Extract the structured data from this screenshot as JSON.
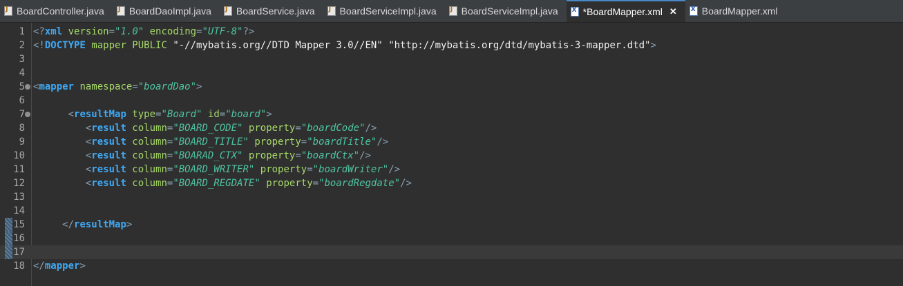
{
  "tabs": [
    {
      "label": "BoardController.java",
      "icon": "java-file-icon",
      "active": false
    },
    {
      "label": "BoardDaoImpl.java",
      "icon": "java-file-icon",
      "active": false
    },
    {
      "label": "BoardService.java",
      "icon": "java-file-icon",
      "active": false
    },
    {
      "label": "BoardServiceImpl.java",
      "icon": "java-file-icon",
      "active": false
    },
    {
      "label": "BoardServiceImpl.java",
      "icon": "java-file-icon",
      "active": false
    },
    {
      "label": "*BoardMapper.xml",
      "icon": "xml-file-icon",
      "active": true,
      "close": "✕"
    },
    {
      "label": "BoardMapper.xml",
      "icon": "xml-file-icon",
      "active": false
    }
  ],
  "editor": {
    "current_line": 17,
    "lines": [
      {
        "n": "1",
        "tokens": [
          [
            "br",
            "<?"
          ],
          [
            "kw",
            "xml"
          ],
          [
            "attr",
            " version"
          ],
          [
            "br",
            "="
          ],
          [
            "val",
            "\"1.0\""
          ],
          [
            "attr",
            " encoding"
          ],
          [
            "br",
            "="
          ],
          [
            "val",
            "\"UTF-8\""
          ],
          [
            "br",
            "?>"
          ]
        ]
      },
      {
        "n": "2",
        "tokens": [
          [
            "br",
            "<!"
          ],
          [
            "kw",
            "DOCTYPE"
          ],
          [
            "doc",
            " mapper PUBLIC "
          ],
          [
            "str",
            "\"-//mybatis.org//DTD Mapper 3.0//EN\""
          ],
          [
            "doc",
            " "
          ],
          [
            "str",
            "\"http://mybatis.org/dtd/mybatis-3-mapper.dtd\""
          ],
          [
            "br",
            ">"
          ]
        ]
      },
      {
        "n": "3",
        "tokens": []
      },
      {
        "n": "4",
        "tokens": []
      },
      {
        "n": "5",
        "fold": true,
        "tokens": [
          [
            "br",
            "<"
          ],
          [
            "tag",
            "mapper"
          ],
          [
            "attr",
            " namespace"
          ],
          [
            "br",
            "="
          ],
          [
            "val",
            "\"boardDao\""
          ],
          [
            "br",
            ">"
          ]
        ]
      },
      {
        "n": "6",
        "tokens": []
      },
      {
        "n": "7",
        "fold": true,
        "tokens": [
          [
            "str",
            "      "
          ],
          [
            "br",
            "<"
          ],
          [
            "tag",
            "resultMap"
          ],
          [
            "attr",
            " type"
          ],
          [
            "br",
            "="
          ],
          [
            "val",
            "\"Board\""
          ],
          [
            "attr",
            " id"
          ],
          [
            "br",
            "="
          ],
          [
            "val",
            "\"board\""
          ],
          [
            "br",
            ">"
          ]
        ]
      },
      {
        "n": "8",
        "tokens": [
          [
            "str",
            "         "
          ],
          [
            "br",
            "<"
          ],
          [
            "tag",
            "result"
          ],
          [
            "attr",
            " column"
          ],
          [
            "br",
            "="
          ],
          [
            "val",
            "\"BOARD_CODE\""
          ],
          [
            "attr",
            " property"
          ],
          [
            "br",
            "="
          ],
          [
            "val",
            "\"boardCode\""
          ],
          [
            "br",
            "/>"
          ]
        ]
      },
      {
        "n": "9",
        "tokens": [
          [
            "str",
            "         "
          ],
          [
            "br",
            "<"
          ],
          [
            "tag",
            "result"
          ],
          [
            "attr",
            " column"
          ],
          [
            "br",
            "="
          ],
          [
            "val",
            "\"BOARD_TITLE\""
          ],
          [
            "attr",
            " property"
          ],
          [
            "br",
            "="
          ],
          [
            "val",
            "\"boardTitle\""
          ],
          [
            "br",
            "/>"
          ]
        ]
      },
      {
        "n": "10",
        "tokens": [
          [
            "str",
            "         "
          ],
          [
            "br",
            "<"
          ],
          [
            "tag",
            "result"
          ],
          [
            "attr",
            " column"
          ],
          [
            "br",
            "="
          ],
          [
            "val",
            "\"BOARAD_CTX\""
          ],
          [
            "attr",
            " property"
          ],
          [
            "br",
            "="
          ],
          [
            "val",
            "\"boardCtx\""
          ],
          [
            "br",
            "/>"
          ]
        ]
      },
      {
        "n": "11",
        "tokens": [
          [
            "str",
            "         "
          ],
          [
            "br",
            "<"
          ],
          [
            "tag",
            "result"
          ],
          [
            "attr",
            " column"
          ],
          [
            "br",
            "="
          ],
          [
            "val",
            "\"BOARD_WRITER\""
          ],
          [
            "attr",
            " property"
          ],
          [
            "br",
            "="
          ],
          [
            "val",
            "\"boardWriter\""
          ],
          [
            "br",
            "/>"
          ]
        ]
      },
      {
        "n": "12",
        "tokens": [
          [
            "str",
            "         "
          ],
          [
            "br",
            "<"
          ],
          [
            "tag",
            "result"
          ],
          [
            "attr",
            " column"
          ],
          [
            "br",
            "="
          ],
          [
            "val",
            "\"BOARD_REGDATE\""
          ],
          [
            "attr",
            " property"
          ],
          [
            "br",
            "="
          ],
          [
            "val",
            "\"boardRegdate\""
          ],
          [
            "br",
            "/>"
          ]
        ]
      },
      {
        "n": "13",
        "tokens": []
      },
      {
        "n": "14",
        "tokens": []
      },
      {
        "n": "15",
        "mark": true,
        "tokens": [
          [
            "str",
            "     "
          ],
          [
            "br",
            "</"
          ],
          [
            "tag",
            "resultMap"
          ],
          [
            "br",
            ">"
          ]
        ]
      },
      {
        "n": "16",
        "mark": true,
        "tokens": []
      },
      {
        "n": "17",
        "mark": true,
        "tokens": []
      },
      {
        "n": "18",
        "tokens": [
          [
            "br",
            "</"
          ],
          [
            "tag",
            "mapper"
          ],
          [
            "br",
            ">"
          ]
        ]
      }
    ]
  },
  "colors": {
    "background": "#2f2f2f",
    "tag": "#3fa9f5",
    "attribute": "#a6d96a",
    "attribute_value": "#4fc3a1",
    "string": "#f0f0f0",
    "bracket": "#8aa0b4",
    "line_number": "#a8a8a8"
  }
}
